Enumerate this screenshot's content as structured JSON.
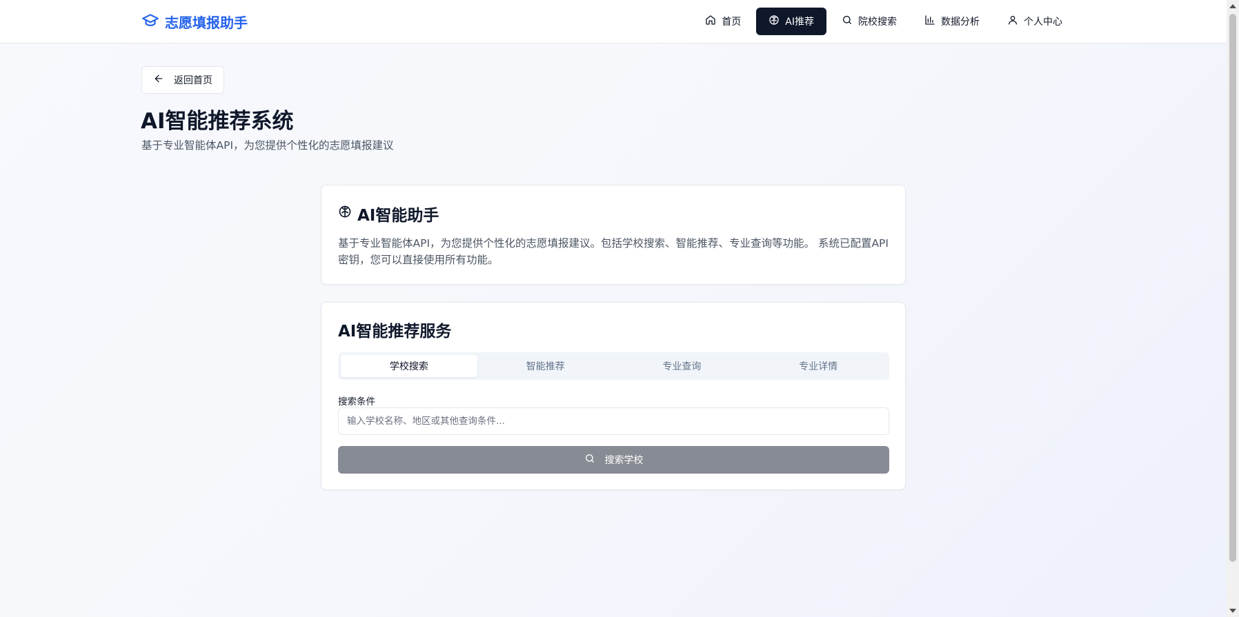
{
  "header": {
    "brand": "志愿填报助手",
    "nav": [
      {
        "label": "首页",
        "icon": "home-icon"
      },
      {
        "label": "AI推荐",
        "icon": "brain-icon",
        "active": true
      },
      {
        "label": "院校搜索",
        "icon": "search-icon"
      },
      {
        "label": "数据分析",
        "icon": "bar-chart-icon"
      },
      {
        "label": "个人中心",
        "icon": "user-icon"
      }
    ]
  },
  "back_button": {
    "label": "返回首页"
  },
  "page": {
    "title": "AI智能推荐系统",
    "subtitle": "基于专业智能体API，为您提供个性化的志愿填报建议"
  },
  "intro_card": {
    "title": "AI智能助手",
    "text": "基于专业智能体API，为您提供个性化的志愿填报建议。包括学校搜索、智能推荐、专业查询等功能。 系统已配置API密钥，您可以直接使用所有功能。"
  },
  "service_card": {
    "title": "AI智能推荐服务",
    "tabs": [
      "学校搜索",
      "智能推荐",
      "专业查询",
      "专业详情"
    ],
    "active_tab": 0,
    "field_label": "搜索条件",
    "input_placeholder": "输入学校名称、地区或其他查询条件...",
    "input_value": "",
    "search_button": "搜索学校"
  },
  "colors": {
    "brand": "#2563eb",
    "nav_active_bg": "#0f172a",
    "button_disabled": "#878b93"
  }
}
